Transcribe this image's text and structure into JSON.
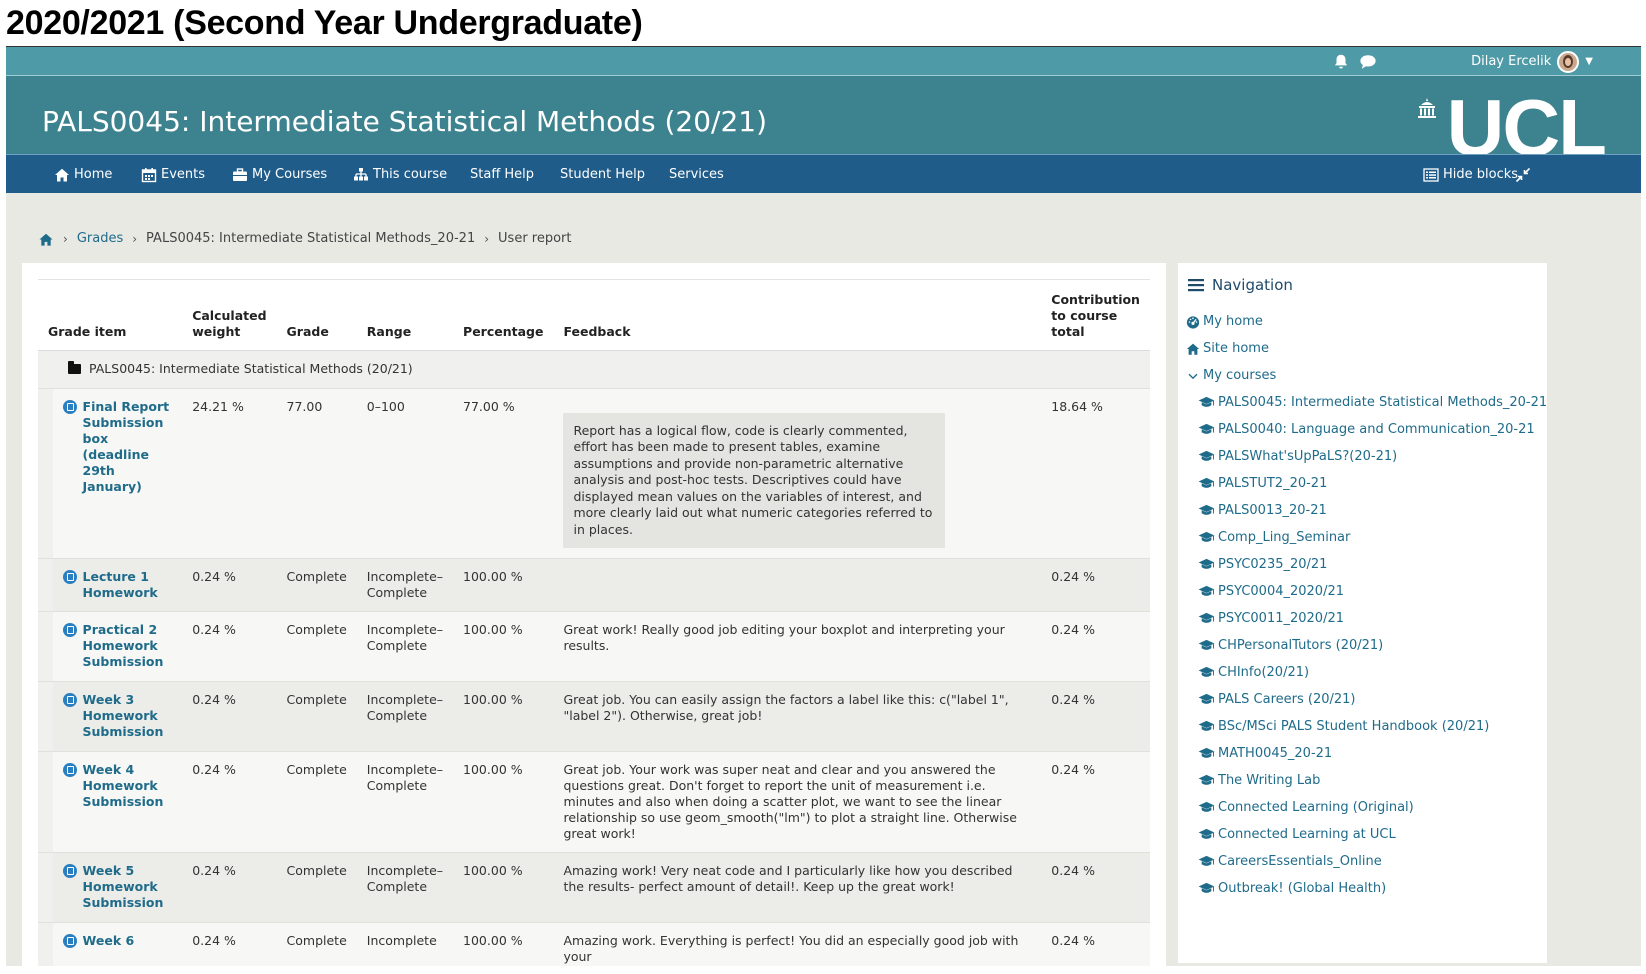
{
  "doc_heading": "2020/2021 (Second Year Undergraduate)",
  "topbar": {
    "user_name": "Dilay Ercelik",
    "icons": [
      "bell-icon",
      "chat-bubble-icon",
      "avatar",
      "caret-down-icon"
    ]
  },
  "header": {
    "course_title": "PALS0045: Intermediate Statistical Methods (20/21)",
    "logo_text": "UCL"
  },
  "navbar": {
    "items": [
      {
        "label": "Home",
        "icon": "home-icon"
      },
      {
        "label": "Events",
        "icon": "calendar-icon"
      },
      {
        "label": "My Courses",
        "icon": "briefcase-icon"
      },
      {
        "label": "This course",
        "icon": "sitemap-icon"
      },
      {
        "label": "Staff Help"
      },
      {
        "label": "Student Help"
      },
      {
        "label": "Services"
      }
    ],
    "hide_blocks": "Hide blocks"
  },
  "breadcrumb": {
    "items": [
      "Grades",
      "PALS0045: Intermediate Statistical Methods_20-21",
      "User report"
    ]
  },
  "grades_table": {
    "headers": {
      "grade_item": "Grade item",
      "weight": "Calculated weight",
      "grade": "Grade",
      "range": "Range",
      "percentage": "Percentage",
      "feedback": "Feedback",
      "contribution": "Contribution to course total"
    },
    "category": "PALS0045: Intermediate Statistical Methods (20/21)",
    "rows": [
      {
        "item": "Final Report Submission box (deadline 29th January)",
        "weight": "24.21 %",
        "grade": "77.00",
        "range": "0–100",
        "percentage": "77.00 %",
        "feedback": "Report has a logical flow, code is clearly commented, effort has been made to present tables, examine assumptions and provide non-parametric alternative analysis and post-hoc tests. Descriptives could have displayed mean values on the variables of interest, and more clearly laid out what numeric categories referred to in places.",
        "contribution": "18.64 %"
      },
      {
        "item": "Lecture 1 Homework",
        "weight": "0.24 %",
        "grade": "Complete",
        "range": "Incomplete–Complete",
        "percentage": "100.00 %",
        "feedback": "",
        "contribution": "0.24 %"
      },
      {
        "item": "Practical 2 Homework Submission",
        "weight": "0.24 %",
        "grade": "Complete",
        "range": "Incomplete–Complete",
        "percentage": "100.00 %",
        "feedback": "Great work! Really good job editing your boxplot and interpreting your results.",
        "contribution": "0.24 %"
      },
      {
        "item": "Week 3 Homework Submission",
        "weight": "0.24 %",
        "grade": "Complete",
        "range": "Incomplete–Complete",
        "percentage": "100.00 %",
        "feedback": "Great job. You can easily assign the factors a label like this: c(\"label 1\", \"label 2\"). Otherwise, great job!",
        "contribution": "0.24 %"
      },
      {
        "item": "Week 4 Homework Submission",
        "weight": "0.24 %",
        "grade": "Complete",
        "range": "Incomplete–Complete",
        "percentage": "100.00 %",
        "feedback": "Great job. Your work was super neat and clear and you answered the questions great. Don't forget to report the unit of measurement i.e. minutes and also when doing a scatter plot, we want to see the linear relationship so use geom_smooth(\"lm\") to plot a straight line. Otherwise great work!",
        "contribution": "0.24 %"
      },
      {
        "item": "Week 5 Homework Submission",
        "weight": "0.24 %",
        "grade": "Complete",
        "range": "Incomplete–Complete",
        "percentage": "100.00 %",
        "feedback": "Amazing work! Very neat code and I particularly like how you described the results- perfect amount of detail!. Keep up the great work!",
        "contribution": "0.24 %"
      },
      {
        "item": "Week 6",
        "weight": "0.24 %",
        "grade": "Complete",
        "range": "Incomplete",
        "percentage": "100.00 %",
        "feedback": "Amazing work. Everything is perfect! You did an especially good job with your",
        "contribution": "0.24 %"
      }
    ]
  },
  "sidebar": {
    "heading": "Navigation",
    "my_home": "My home",
    "site_home": "Site home",
    "my_courses": "My courses",
    "courses": [
      "PALS0045: Intermediate Statistical Methods_20-21",
      "PALS0040: Language and Communication_20-21",
      "PALSWhat'sUpPaLS?(20-21)",
      "PALSTUT2_20-21",
      "PALS0013_20-21",
      "Comp_Ling_Seminar",
      "PSYC0235_20/21",
      "PSYC0004_2020/21",
      "PSYC0011_2020/21",
      "CHPersonalTutors (20/21)",
      "CHInfo(20/21)",
      "PALS Careers (20/21)",
      "BSc/MSci PALS Student Handbook (20/21)",
      "MATH0045_20-21",
      "The Writing Lab",
      "Connected Learning (Original)",
      "Connected Learning at UCL",
      "CareersEssentials_Online",
      "Outbreak! (Global Health)"
    ]
  }
}
